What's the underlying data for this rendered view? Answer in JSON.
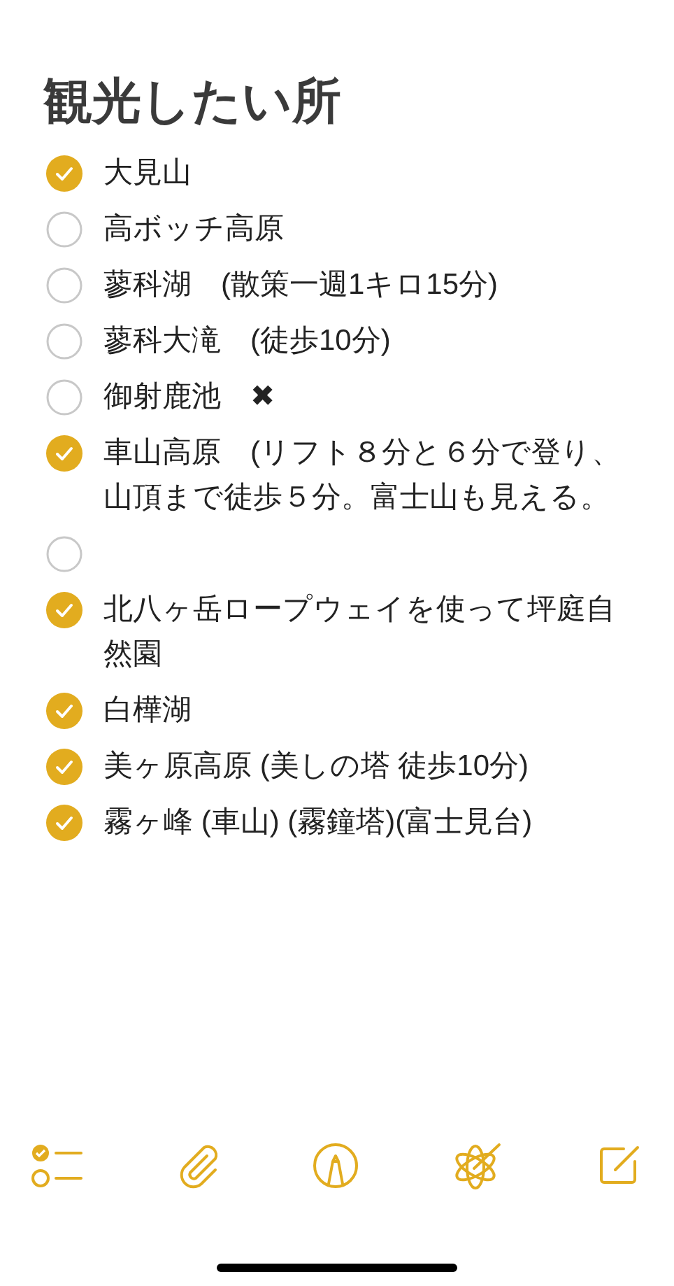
{
  "title": "観光したい所",
  "items": [
    {
      "text": "大見山",
      "checked": true
    },
    {
      "text": "高ボッチ高原",
      "checked": false
    },
    {
      "text": "蓼科湖　(散策一週1キロ15分)",
      "checked": false
    },
    {
      "text": "蓼科大滝　(徒歩10分)",
      "checked": false
    },
    {
      "text": "御射鹿池　✖",
      "checked": false
    },
    {
      "text": "車山高原　(リフト８分と６分で登り、山頂まで徒歩５分。富士山も見える。",
      "checked": true
    },
    {
      "checked": false
    },
    {
      "text": "北八ヶ岳ロープウェイを使って坪庭自然園",
      "checked": true
    },
    {
      "text": "白樺湖",
      "checked": true
    },
    {
      "text": "美ヶ原高原 (美しの塔 徒歩10分)",
      "checked": true
    },
    {
      "text": "霧ヶ峰 (車山) (霧鐘塔)(富士見台)",
      "checked": true
    }
  ]
}
